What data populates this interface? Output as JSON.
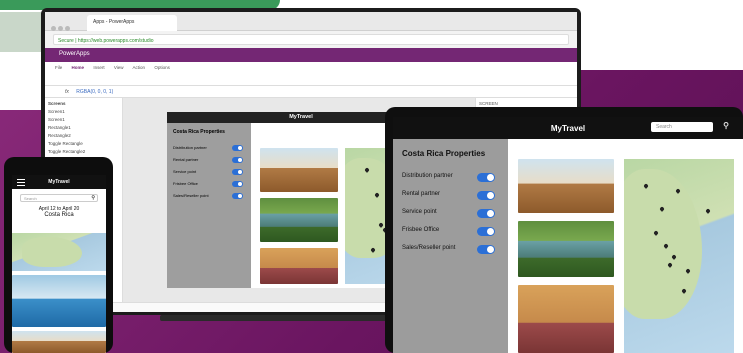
{
  "browser": {
    "tab_title": "Apps - PowerApps",
    "url": "Secure | https://web.powerapps.com/studio"
  },
  "studio": {
    "app_name": "PowerApps",
    "menu": [
      "File",
      "Home",
      "Insert",
      "View",
      "Action",
      "Options"
    ],
    "menu_active": "Home",
    "formula_prefix": "fx",
    "formula_value": "RGBA(0, 0, 0, 1)",
    "tree_header": "Screens",
    "tree_items": [
      "Screen1",
      "Screen1",
      "Rectangle1",
      "Rectangle2",
      "Toggle Rectangle",
      "Toggle Rectangle2",
      "Toggle Rectangle3"
    ],
    "right_header": "SCREEN",
    "right_sub": "Screen1",
    "status_left": "Screen1",
    "status_right": "Interactive",
    "status_zoom": "Off"
  },
  "mytravel": {
    "title": "MyTravel",
    "search_placeholder": "Search",
    "sidebar_title": "Costa Rica Properties",
    "filters": [
      "Distribution partner",
      "Rental partner",
      "Service point",
      "Frisbee Office",
      "Sales/Reseller point"
    ],
    "filter_states": [
      true,
      true,
      true,
      true,
      true
    ]
  },
  "phone": {
    "title": "MyTravel",
    "search_placeholder": "Search",
    "dates": "April 12 to April 20",
    "country": "Costa Rica"
  },
  "colors": {
    "brand_purple": "#742774",
    "toggle_blue": "#2b6fd6",
    "sidebar_grey": "#9c9c9c",
    "header_black": "#111111"
  }
}
